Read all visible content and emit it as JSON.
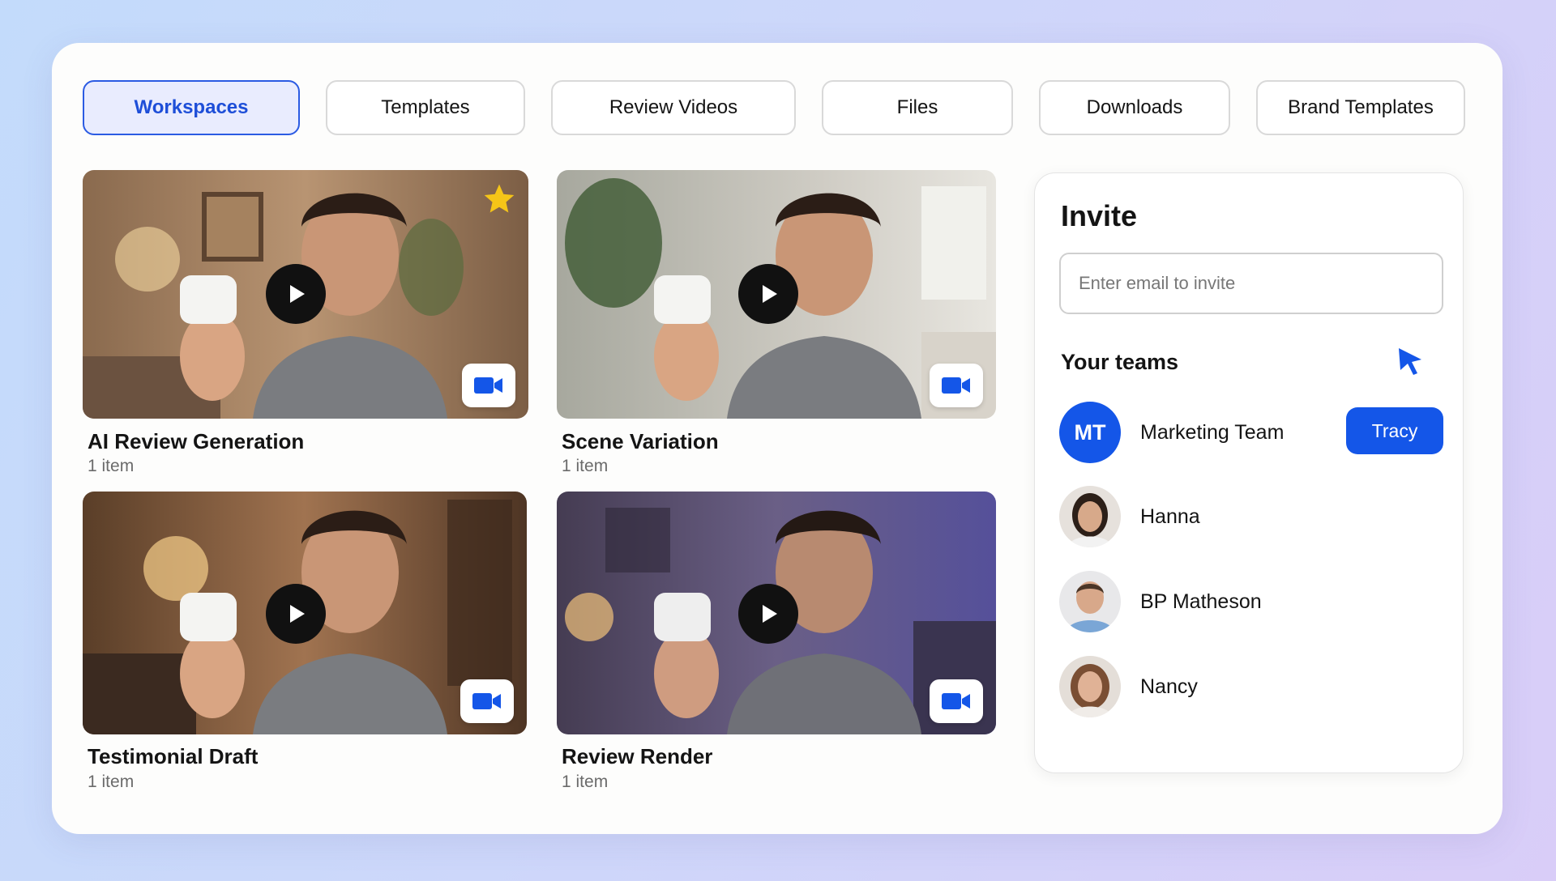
{
  "tabs": [
    {
      "label": "Workspaces",
      "active": true
    },
    {
      "label": "Templates",
      "active": false
    },
    {
      "label": "Review Videos",
      "active": false
    },
    {
      "label": "Files",
      "active": false
    },
    {
      "label": "Downloads",
      "active": false
    },
    {
      "label": "Brand Templates",
      "active": false
    }
  ],
  "cards": [
    {
      "title": "AI Review Generation",
      "subtitle": "1 item",
      "starred": true
    },
    {
      "title": "Scene Variation",
      "subtitle": "1 item",
      "starred": false
    },
    {
      "title": "Testimonial Draft",
      "subtitle": "1 item",
      "starred": false
    },
    {
      "title": "Review Render",
      "subtitle": "1 item",
      "starred": false
    }
  ],
  "invite": {
    "title": "Invite",
    "placeholder": "Enter email to invite",
    "teams_label": "Your teams",
    "members": [
      {
        "initials": "MT",
        "name": "Marketing Team",
        "button": "Tracy"
      },
      {
        "name": "Hanna"
      },
      {
        "name": "BP Matheson"
      },
      {
        "name": "Nancy"
      }
    ]
  },
  "colors": {
    "accent": "#1456e8",
    "active_tab_bg": "#e9ecfe",
    "star": "#f5c518"
  },
  "icons": {
    "play": "play-icon",
    "camera": "video-camera-icon",
    "star": "star-icon",
    "cursor": "mouse-pointer-icon"
  }
}
